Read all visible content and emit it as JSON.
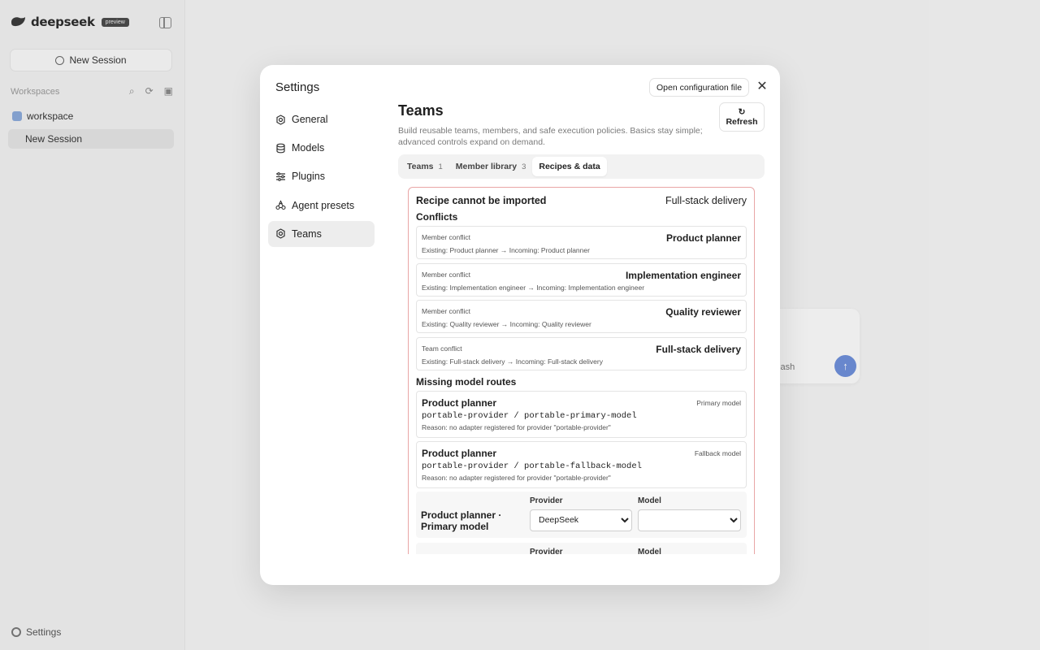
{
  "app": {
    "brand": "deepseek",
    "badge": "preview",
    "new_session": "New Session",
    "workspaces_label": "Workspaces",
    "workspace_name": "workspace",
    "session_name": "New Session",
    "settings_label": "Settings",
    "composer_model": "flash"
  },
  "modal": {
    "title": "Settings",
    "open_config": "Open configuration file",
    "close": "✕",
    "nav": [
      {
        "label": "General",
        "icon": "gear-icon"
      },
      {
        "label": "Models",
        "icon": "database-icon"
      },
      {
        "label": "Plugins",
        "icon": "sliders-icon"
      },
      {
        "label": "Agent presets",
        "icon": "agent-icon"
      },
      {
        "label": "Teams",
        "icon": "gear-icon"
      }
    ],
    "active_nav": "Teams"
  },
  "teams": {
    "title": "Teams",
    "description": "Build reusable teams, members, and safe execution policies. Basics stay simple; advanced controls expand on demand.",
    "refresh_icon": "↻",
    "refresh_label": "Refresh",
    "tabs": [
      {
        "label": "Teams",
        "count": "1"
      },
      {
        "label": "Member library",
        "count": "3"
      },
      {
        "label": "Recipes & data",
        "count": ""
      }
    ],
    "active_tab": "Recipes & data"
  },
  "recipe": {
    "title": "Recipe cannot be imported",
    "team_name": "Full-stack delivery",
    "conflicts_title": "Conflicts",
    "conflicts": [
      {
        "kind": "Member conflict",
        "detail": "Existing: Product planner → Incoming: Product planner",
        "name": "Product planner"
      },
      {
        "kind": "Member conflict",
        "detail": "Existing: Implementation engineer → Incoming: Implementation engineer",
        "name": "Implementation engineer"
      },
      {
        "kind": "Member conflict",
        "detail": "Existing: Quality reviewer → Incoming: Quality reviewer",
        "name": "Quality reviewer"
      },
      {
        "kind": "Team conflict",
        "detail": "Existing: Full-stack delivery → Incoming: Full-stack delivery",
        "name": "Full-stack delivery"
      }
    ],
    "missing_title": "Missing model routes",
    "missing": [
      {
        "name": "Product planner",
        "route": "portable-provider / portable-primary-model",
        "reason": "Reason: no adapter registered for provider \"portable-provider\"",
        "role": "Primary model"
      },
      {
        "name": "Product planner",
        "route": "portable-provider / portable-fallback-model",
        "reason": "Reason: no adapter registered for provider \"portable-provider\"",
        "role": "Fallback model"
      }
    ],
    "routes": [
      {
        "label": "Product planner · Primary model",
        "provider_label": "Provider",
        "provider_value": "DeepSeek",
        "model_label": "Model",
        "model_value": ""
      },
      {
        "label": "",
        "provider_label": "Provider",
        "provider_value": "",
        "model_label": "Model",
        "model_value": ""
      }
    ]
  }
}
